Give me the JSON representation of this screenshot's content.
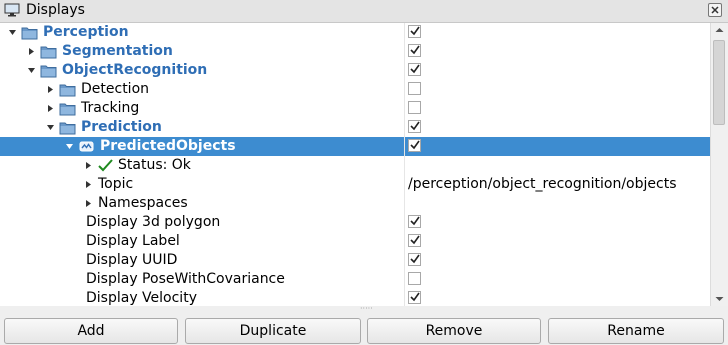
{
  "window": {
    "title": "Displays",
    "icon": "monitor-icon",
    "close_icon": "close-icon"
  },
  "tree": {
    "rows": [
      {
        "name": "Perception",
        "level": 0,
        "expanded": true,
        "icon": "folder-icon",
        "bold_blue": true,
        "checkbox": true,
        "checked": true
      },
      {
        "name": "Segmentation",
        "level": 1,
        "expanded": false,
        "icon": "folder-icon",
        "bold_blue": true,
        "checkbox": true,
        "checked": true
      },
      {
        "name": "ObjectRecognition",
        "level": 1,
        "expanded": true,
        "icon": "folder-icon",
        "bold_blue": true,
        "checkbox": true,
        "checked": true
      },
      {
        "name": "Detection",
        "level": 2,
        "expanded": false,
        "icon": "folder-icon",
        "bold_blue": false,
        "checkbox": true,
        "checked": false
      },
      {
        "name": "Tracking",
        "level": 2,
        "expanded": false,
        "icon": "folder-icon",
        "bold_blue": false,
        "checkbox": true,
        "checked": false
      },
      {
        "name": "Prediction",
        "level": 2,
        "expanded": true,
        "icon": "folder-icon",
        "bold_blue": true,
        "checkbox": true,
        "checked": true
      },
      {
        "name": "PredictedObjects",
        "level": 3,
        "expanded": true,
        "icon": "plugin-icon",
        "bold_blue": true,
        "checkbox": true,
        "checked": true,
        "selected": true
      },
      {
        "name": "Status: Ok",
        "level": 4,
        "expanded": false,
        "icon": "checkmark-icon",
        "bold_blue": false,
        "checkbox": false
      },
      {
        "name": "Topic",
        "level": 4,
        "expanded": false,
        "icon": "",
        "bold_blue": false,
        "checkbox": false,
        "value": "/perception/object_recognition/objects"
      },
      {
        "name": "Namespaces",
        "level": 4,
        "expanded": false,
        "icon": "",
        "bold_blue": false,
        "checkbox": false
      },
      {
        "name": "Display 3d polygon",
        "level": 4,
        "no_arrow": true,
        "icon": "",
        "bold_blue": false,
        "checkbox": true,
        "checked": true
      },
      {
        "name": "Display Label",
        "level": 4,
        "no_arrow": true,
        "icon": "",
        "bold_blue": false,
        "checkbox": true,
        "checked": true
      },
      {
        "name": "Display UUID",
        "level": 4,
        "no_arrow": true,
        "icon": "",
        "bold_blue": false,
        "checkbox": true,
        "checked": true
      },
      {
        "name": "Display PoseWithCovariance",
        "level": 4,
        "no_arrow": true,
        "icon": "",
        "bold_blue": false,
        "checkbox": true,
        "checked": false
      },
      {
        "name": "Display Velocity",
        "level": 4,
        "no_arrow": true,
        "icon": "",
        "bold_blue": false,
        "checkbox": true,
        "checked": true
      }
    ]
  },
  "buttons": {
    "add": "Add",
    "duplicate": "Duplicate",
    "remove": "Remove",
    "rename": "Rename"
  },
  "colors": {
    "selection": "#3d8cd0",
    "folder_blue": "#2f6eb5",
    "check_green": "#1f8a1f"
  }
}
